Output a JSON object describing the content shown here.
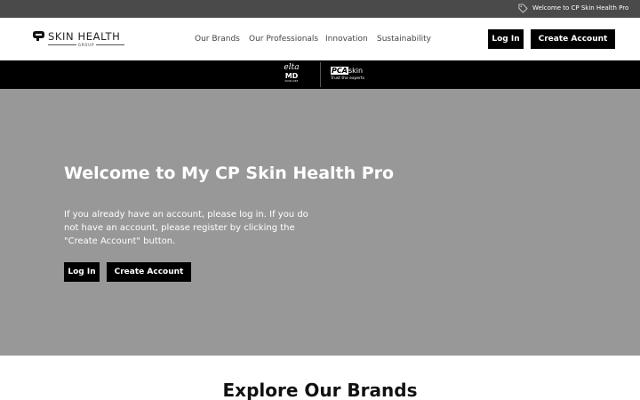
{
  "topbar": {
    "welcome_text": "Welcome to CP Skin Health Pro",
    "icon": "tag-icon"
  },
  "header": {
    "logo_text": "SKIN HEALTH",
    "logo_sub": "GROUP",
    "nav": [
      "Our Brands",
      "Our Professionals",
      "Innovation",
      "Sustainability"
    ],
    "login_label": "Log In",
    "create_label": "Create Account"
  },
  "brands": {
    "elta_top": "elta",
    "elta_md": "MD",
    "elta_sub": "SKINCARE",
    "pca_box": "PCA",
    "pca_word": "skin",
    "pca_tagline": "Trust the experts"
  },
  "hero": {
    "title": "Welcome to My CP Skin Health Pro",
    "text": "If you already have an account, please log in. If you do not have an account, please register by clicking the \"Create Account\" button.",
    "login_label": "Log In",
    "create_label": "Create Account",
    "background": "#989898"
  },
  "explore": {
    "title": "Explore Our Brands"
  }
}
